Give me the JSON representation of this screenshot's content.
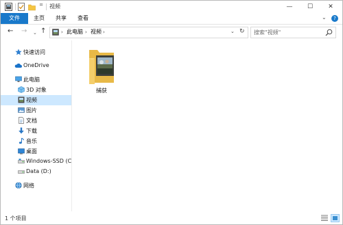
{
  "window": {
    "title": "视频",
    "controls": {
      "minimize": "—",
      "maximize": "☐",
      "close": "✕"
    }
  },
  "quick_access": {
    "pin_glyph": "="
  },
  "ribbon": {
    "tabs": [
      {
        "label": "文件",
        "active": true
      },
      {
        "label": "主页"
      },
      {
        "label": "共享"
      },
      {
        "label": "查看"
      }
    ],
    "expand_glyph": "⌄",
    "help_glyph": "?"
  },
  "navigation": {
    "back": "←",
    "forward": "→",
    "recent": "⌄",
    "up": "↑"
  },
  "address": {
    "segments": [
      "此电脑",
      "视频"
    ],
    "separator": "›",
    "dropdown": "⌄",
    "refresh": "↻"
  },
  "search": {
    "placeholder": "搜索\"视频\""
  },
  "sidebar": {
    "items": [
      {
        "label": "快速访问",
        "icon": "star-icon"
      },
      {
        "label": "OneDrive",
        "icon": "cloud-icon"
      },
      {
        "label": "此电脑",
        "icon": "computer-icon"
      },
      {
        "label": "3D 对象",
        "icon": "cube-icon"
      },
      {
        "label": "视频",
        "icon": "video-icon",
        "selected": true
      },
      {
        "label": "图片",
        "icon": "picture-icon"
      },
      {
        "label": "文档",
        "icon": "document-icon"
      },
      {
        "label": "下载",
        "icon": "download-icon"
      },
      {
        "label": "音乐",
        "icon": "music-icon"
      },
      {
        "label": "桌面",
        "icon": "desktop-icon"
      },
      {
        "label": "Windows-SSD (C:)",
        "icon": "drive-icon"
      },
      {
        "label": "Data (D:)",
        "icon": "drive-icon"
      },
      {
        "label": "网络",
        "icon": "network-icon"
      }
    ]
  },
  "files": [
    {
      "name": "捕获",
      "type": "folder"
    }
  ],
  "status": {
    "item_count": "1 个项目"
  },
  "colors": {
    "accent": "#1979ca",
    "selection": "#cde8ff"
  }
}
